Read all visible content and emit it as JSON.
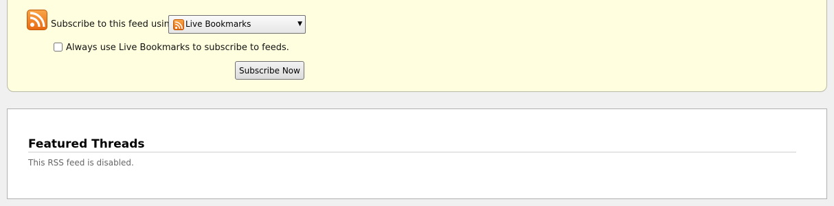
{
  "subscribe": {
    "label": "Subscribe to this feed using",
    "reader": {
      "selected": "Live Bookmarks",
      "icon": "rss-icon"
    },
    "always_use_label": "Always use Live Bookmarks to subscribe to feeds.",
    "always_use_checked": false,
    "button_label": "Subscribe Now"
  },
  "feed": {
    "title": "Featured Threads",
    "message": "This RSS feed is disabled."
  },
  "colors": {
    "subscribe_background": "#ffffdf",
    "rss_orange": "#e86a10"
  }
}
